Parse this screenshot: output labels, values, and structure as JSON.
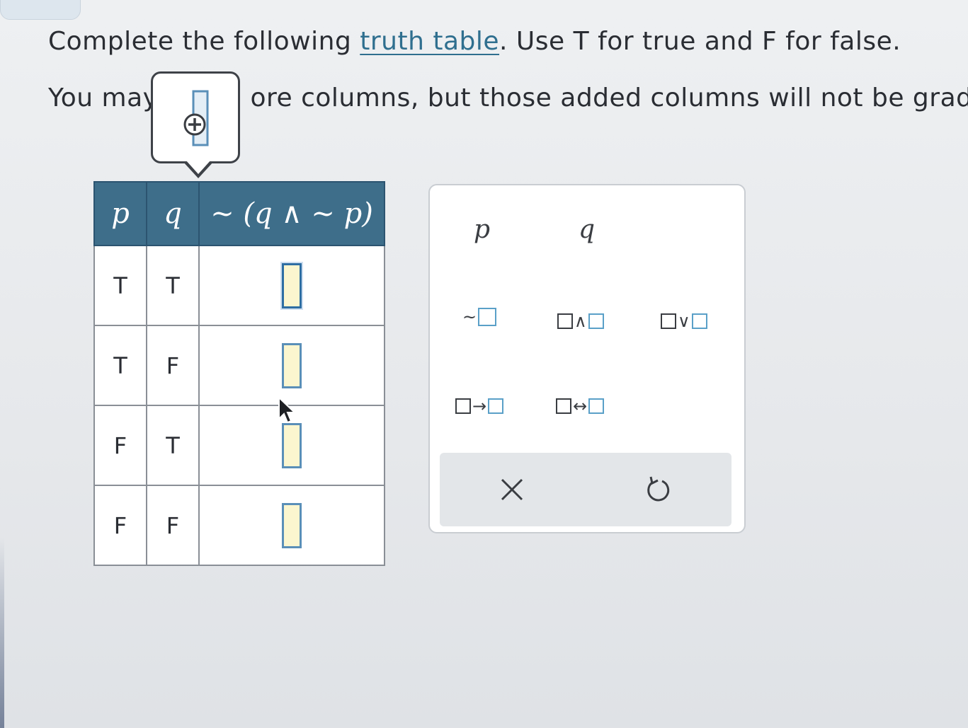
{
  "instructions": {
    "line1_before": "Complete the following ",
    "line1_link": "truth table",
    "line1_after": ". Use T for true and F for false.",
    "line2_start": "You may",
    "line2_end": "ore columns, but those added columns will not be graded."
  },
  "tooltip": {
    "icon": "add-column-icon"
  },
  "truth_table": {
    "headers": [
      "p",
      "q",
      "~ (q ∧ ~ p)"
    ],
    "rows": [
      {
        "p": "T",
        "q": "T"
      },
      {
        "p": "T",
        "q": "F"
      },
      {
        "p": "F",
        "q": "T"
      },
      {
        "p": "F",
        "q": "F"
      }
    ]
  },
  "palette": {
    "variables": [
      "p",
      "q"
    ],
    "operators": {
      "not": "~",
      "and": "∧",
      "or": "∨",
      "implies": "→",
      "biconditional": "↔"
    },
    "footer": {
      "clear_icon": "close-icon",
      "undo_icon": "undo-icon"
    }
  },
  "colors": {
    "header_bg": "#3e6e8a",
    "link": "#2f6f8f",
    "answer_fill": "#fbf6cf",
    "answer_border": "#5a8fb8"
  }
}
